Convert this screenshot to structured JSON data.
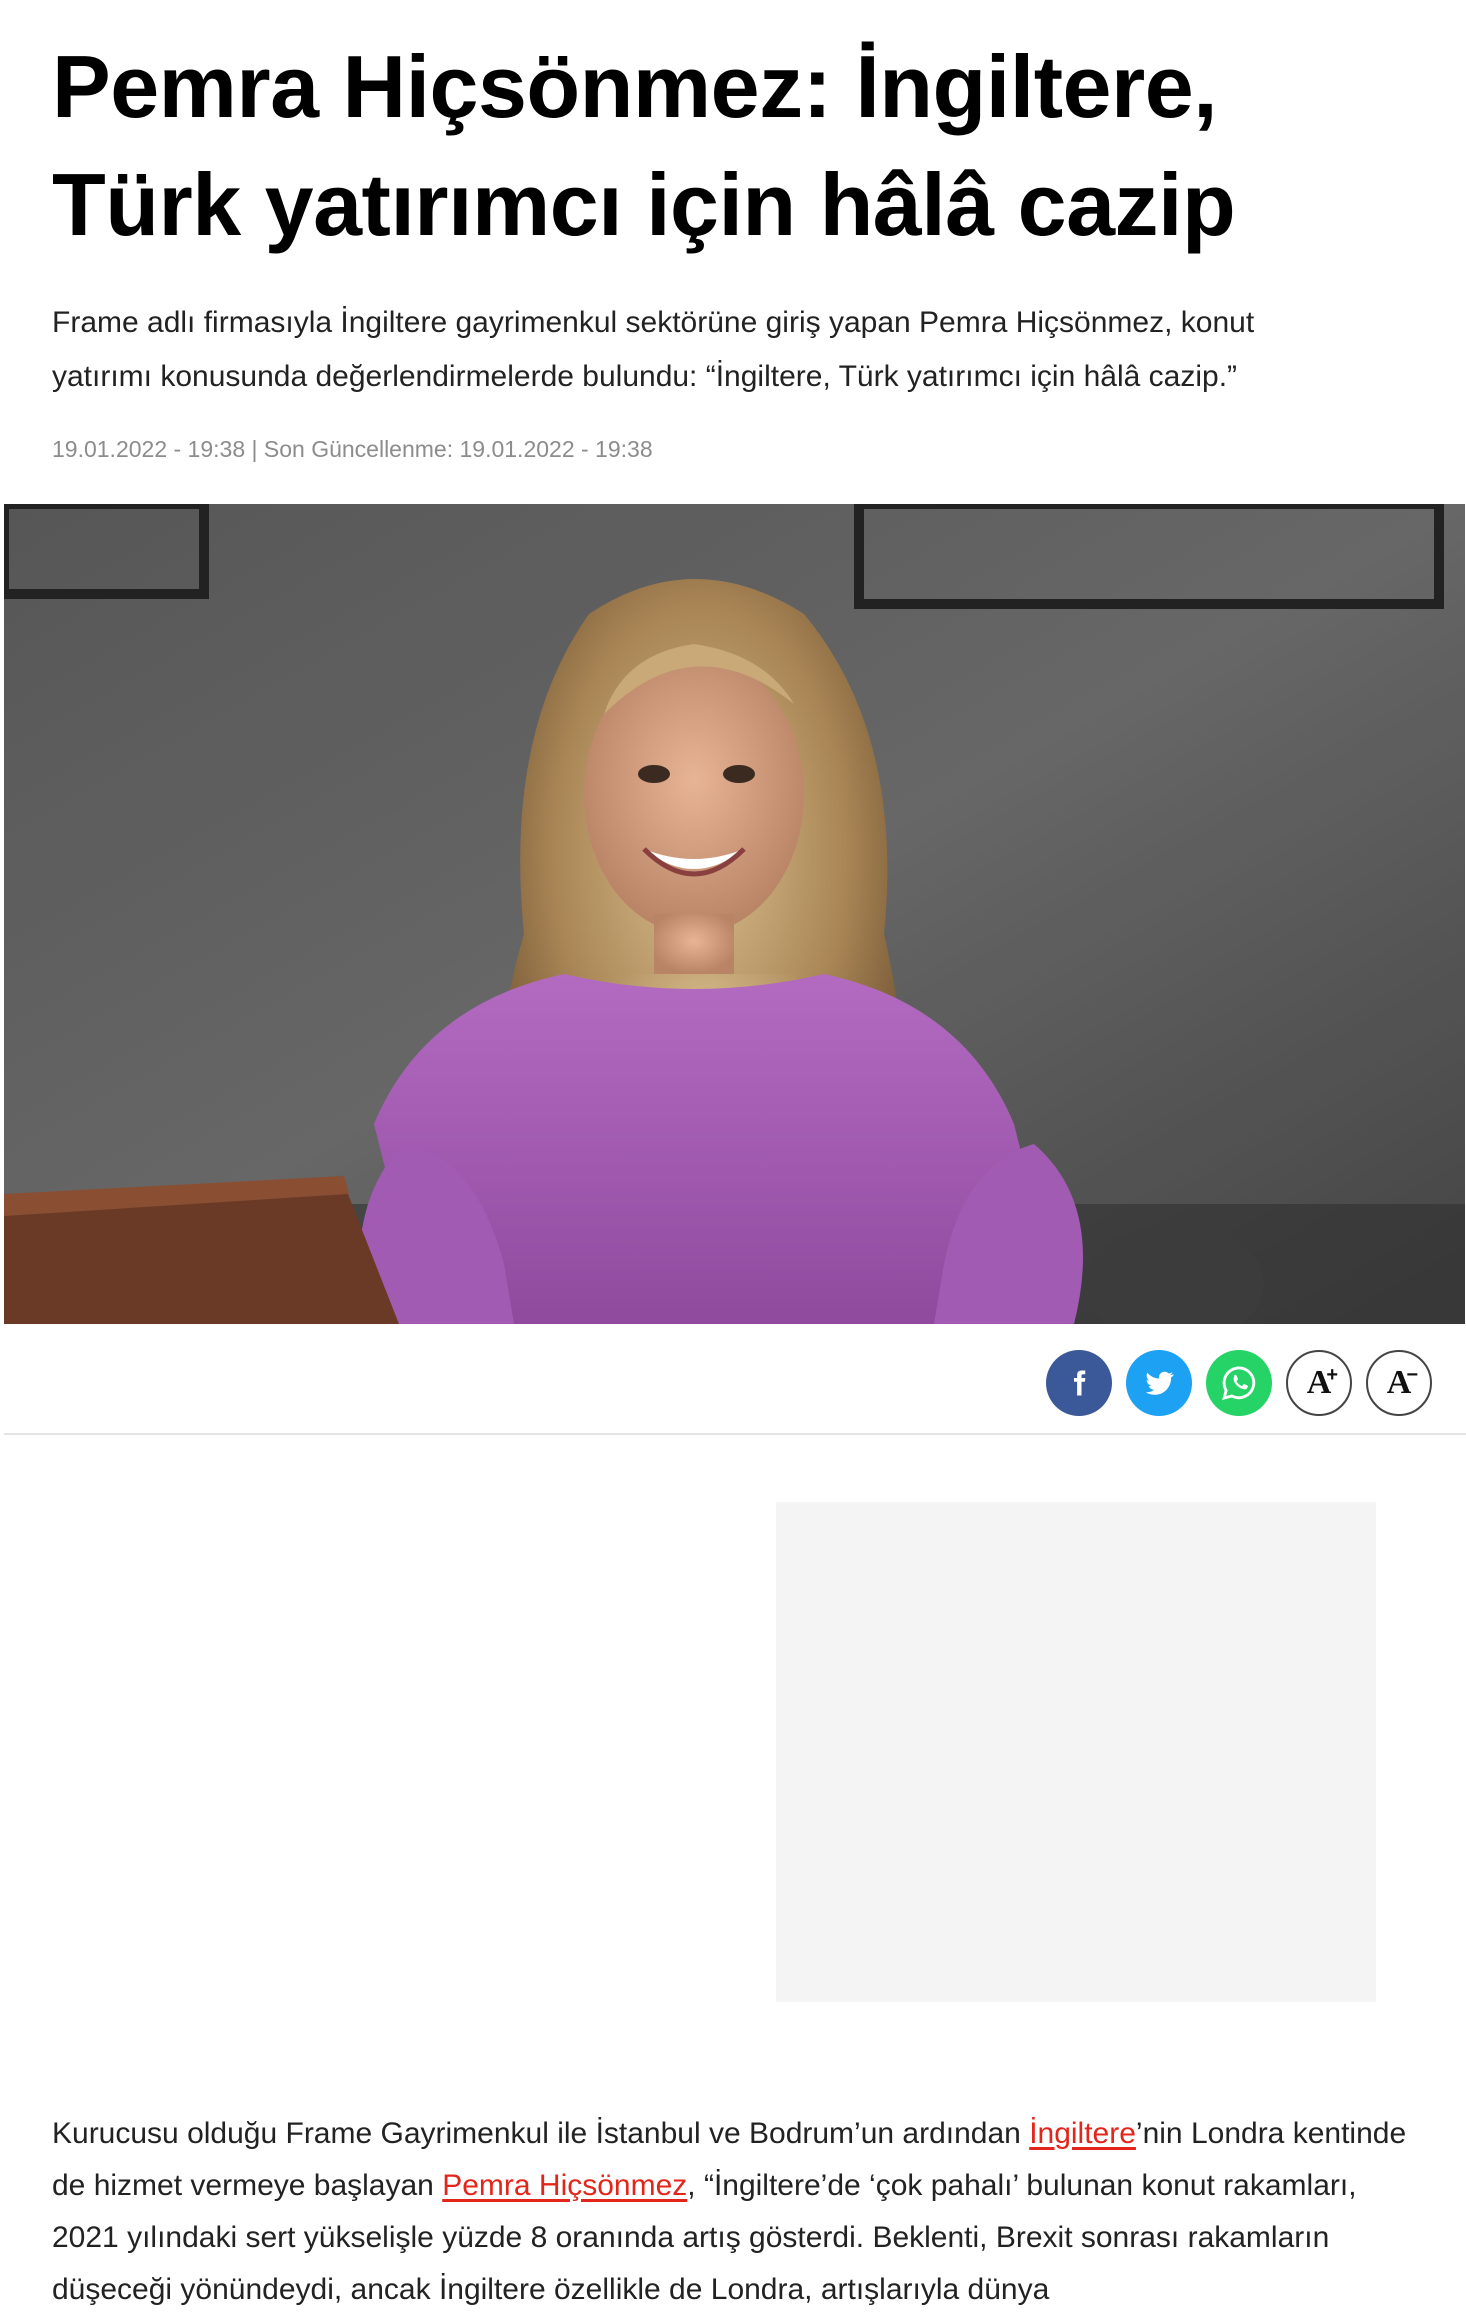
{
  "article": {
    "title_line1": "Pemra Hiçsönmez: İngiltere,",
    "title_line2": "Türk yatırımcı için hâlâ cazip",
    "spot_line1": "Frame adlı firmasıyla İngiltere gayrimenkul sektörüne giriş yapan Pemra Hiçsönmez, konut",
    "spot_line2": "yatırımı konusunda değerlendirmelerde bulundu: “İngiltere, Türk yatırımcı için hâlâ cazip.”",
    "published": "19.01.2022 - 19:38",
    "separator": " | ",
    "updated_label": "Son Güncellenme: ",
    "updated": "19.01.2022 - 19:38"
  },
  "share": {
    "facebook_icon": "facebook-icon",
    "twitter_icon": "twitter-icon",
    "whatsapp_icon": "whatsapp-icon",
    "font_increase": "A",
    "font_increase_sign": "+",
    "font_decrease": "A",
    "font_decrease_sign": "−"
  },
  "body": {
    "p1_a": "Kurucusu olduğu Frame Gayrimenkul ile İstanbul ve Bodrum’un ardından ",
    "link1": "İngiltere",
    "p1_b": "’nin Londra kentinde de hizmet vermeye başlayan ",
    "link2": "Pemra Hiçsönmez",
    "p1_c": ", “İngiltere’de ‘çok pahalı’ bulunan konut rakamları, 2021 yılındaki sert yükselişle yüzde 8 oranında artış gösterdi. Beklenti, Brexit sonrası rakamların düşeceği yönündeydi, ancak İngiltere özellikle de Londra, artışlarıyla dünya"
  },
  "colors": {
    "link": "#e3261b",
    "facebook": "#3b5998",
    "twitter": "#1da1f2",
    "whatsapp": "#25d366"
  }
}
